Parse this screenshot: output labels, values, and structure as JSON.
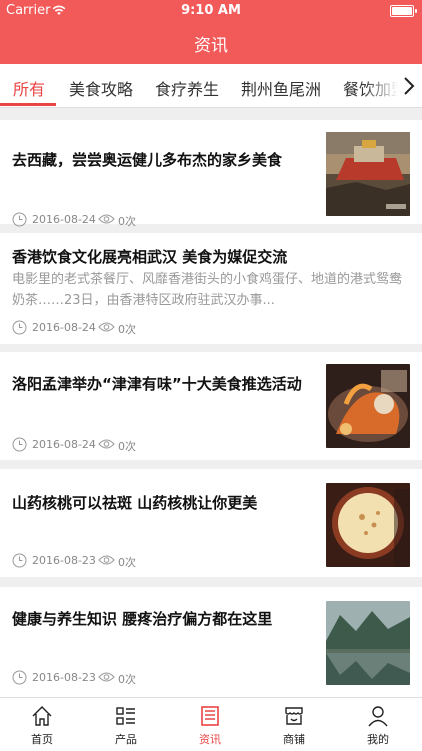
{
  "status_bar": {
    "carrier": "Carrier",
    "time": "9:10 AM"
  },
  "header": {
    "title": "资讯"
  },
  "tabs": [
    {
      "label": "所有",
      "active": true
    },
    {
      "label": "美食攻略"
    },
    {
      "label": "食疗养生"
    },
    {
      "label": "荆州鱼尾洲"
    },
    {
      "label": "餐饮加盟"
    }
  ],
  "articles": [
    {
      "title": "去西藏，尝尝奥运健儿多布杰的家乡美食",
      "date": "2016-08-24",
      "views": "0次",
      "thumb": "potala-palace"
    },
    {
      "title": "香港饮食文化展亮相武汉 美食为媒促交流",
      "desc": "电影里的老式茶餐厅、风靡香港街头的小食鸡蛋仔、地道的港式鸳鸯奶茶……23日，由香港特区政府驻武汉办事...",
      "date": "2016-08-24",
      "views": "0次"
    },
    {
      "title": "洛阳孟津举办“津津有味”十大美食推选活动",
      "date": "2016-08-24",
      "views": "0次",
      "thumb": "food-display"
    },
    {
      "title": "山药核桃可以祛斑 山药核桃让你更美",
      "date": "2016-08-23",
      "views": "0次",
      "thumb": "walnut-soup"
    },
    {
      "title": "健康与养生知识 腰疼治疗偏方都在这里",
      "date": "2016-08-23",
      "views": "0次",
      "thumb": "mountain-lake"
    }
  ],
  "tabbar": [
    {
      "label": "首页",
      "icon": "home-icon"
    },
    {
      "label": "产品",
      "icon": "list-icon"
    },
    {
      "label": "资讯",
      "icon": "news-icon",
      "active": true
    },
    {
      "label": "商铺",
      "icon": "shop-icon"
    },
    {
      "label": "我的",
      "icon": "user-icon"
    }
  ],
  "colors": {
    "brand": "#f25a5a",
    "active": "#e94545"
  }
}
